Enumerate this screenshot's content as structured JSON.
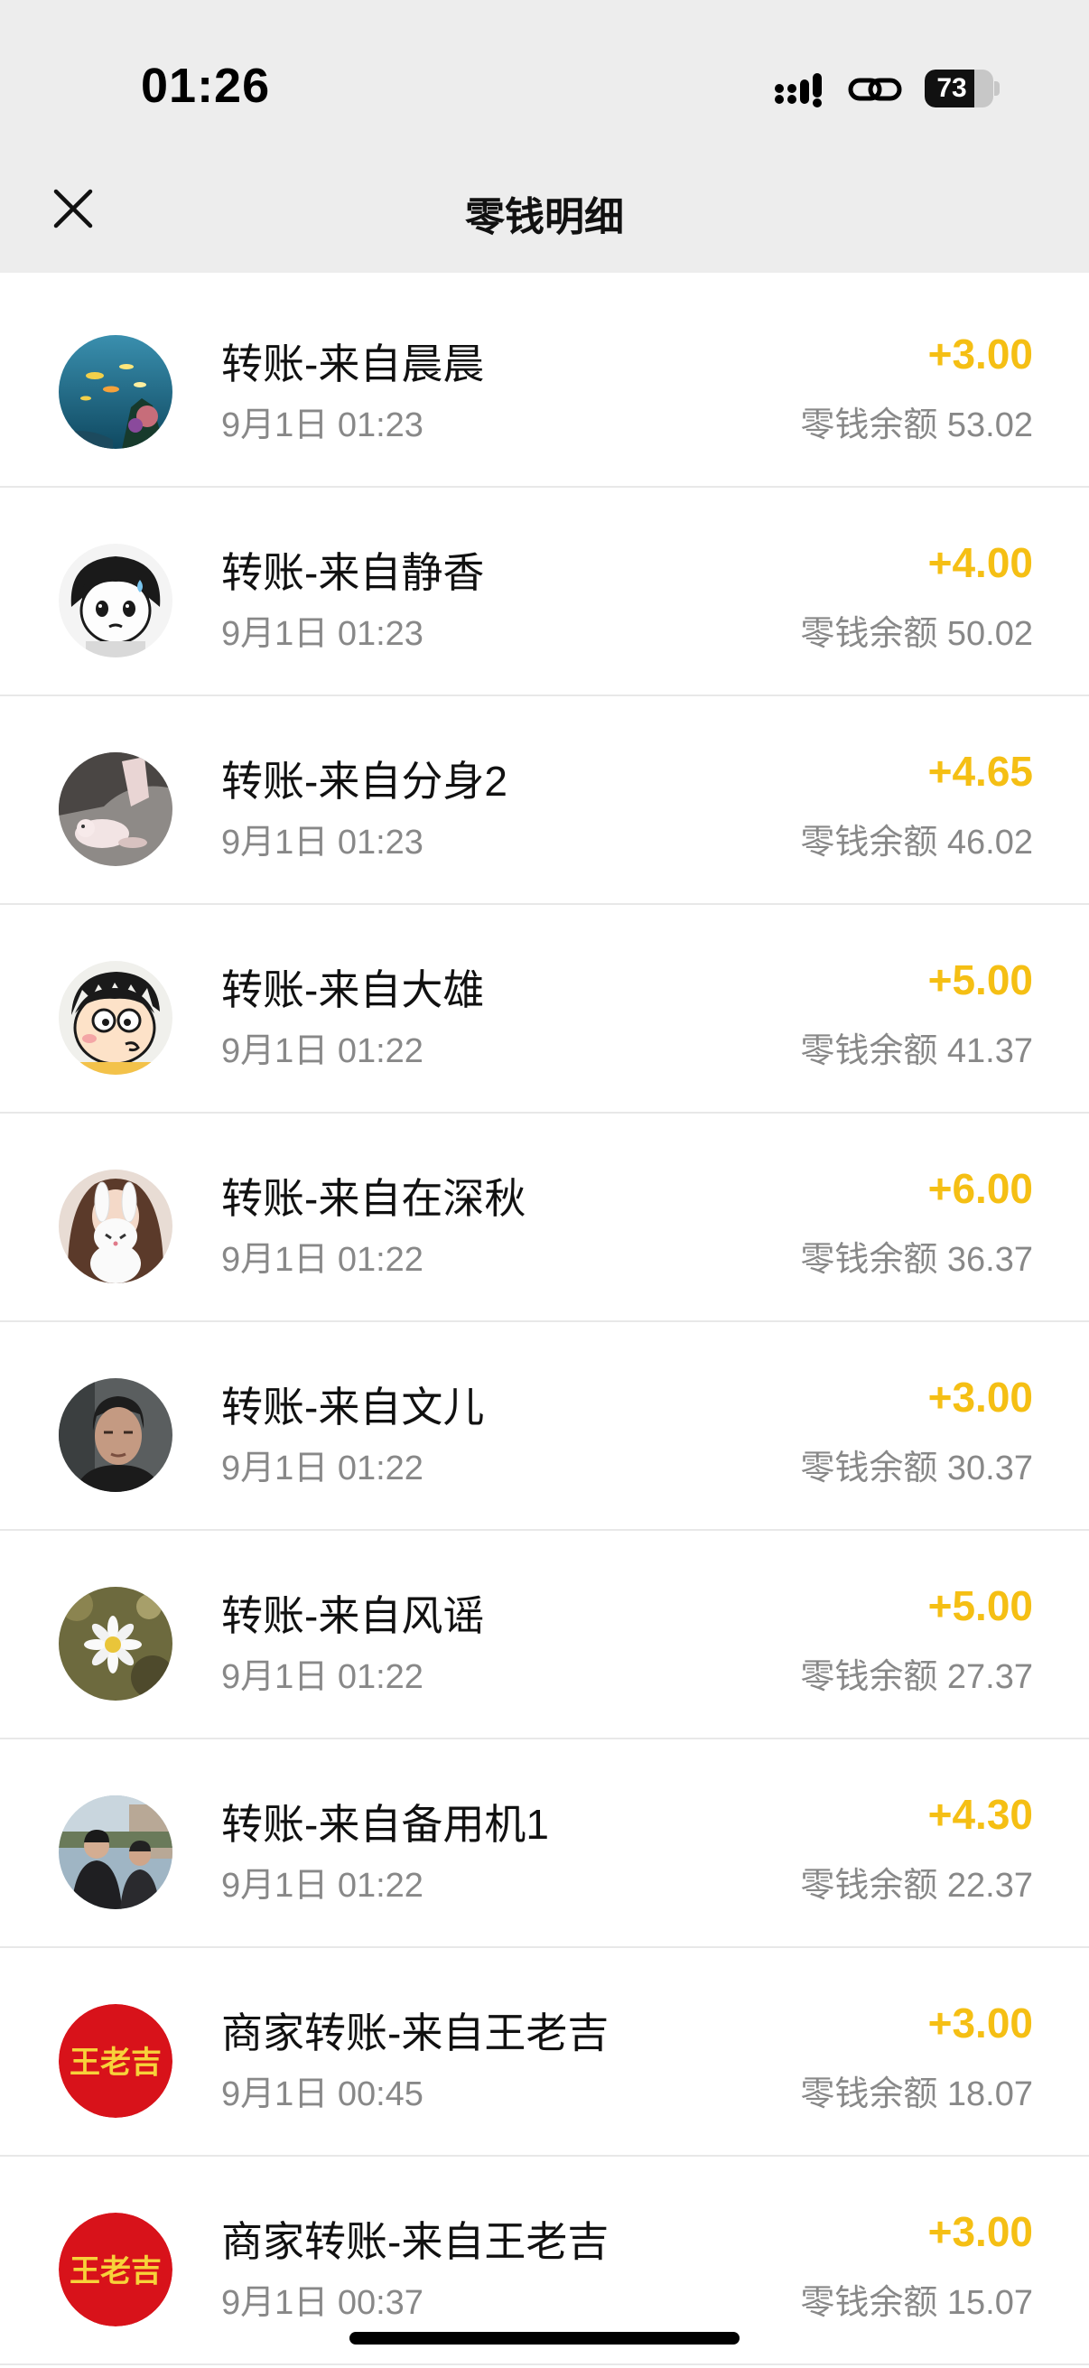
{
  "status_bar": {
    "time": "01:26",
    "battery": "73",
    "battery_level": 0.73
  },
  "header": {
    "title": "零钱明细"
  },
  "colors": {
    "amount": "#f5bf14",
    "header_bg": "#ededed",
    "secondary_text": "#888888"
  },
  "transactions": [
    {
      "title": "转账-来自晨晨",
      "date": "9月1日 01:23",
      "amount": "+3.00",
      "balance": "零钱余额 53.02",
      "avatar": "ocean-fish-avatar"
    },
    {
      "title": "转账-来自静香",
      "date": "9月1日 01:23",
      "amount": "+4.00",
      "balance": "零钱余额 50.02",
      "avatar": "cartoon-girl-avatar"
    },
    {
      "title": "转账-来自分身2",
      "date": "9月1日 01:23",
      "amount": "+4.65",
      "balance": "零钱余额 46.02",
      "avatar": "plush-toy-avatar"
    },
    {
      "title": "转账-来自大雄",
      "date": "9月1日 01:22",
      "amount": "+5.00",
      "balance": "零钱余额 41.37",
      "avatar": "cartoon-boy-avatar"
    },
    {
      "title": "转账-来自在深秋",
      "date": "9月1日 01:22",
      "amount": "+6.00",
      "balance": "零钱余额 36.37",
      "avatar": "girl-with-bunny-avatar"
    },
    {
      "title": "转账-来自文儿",
      "date": "9月1日 01:22",
      "amount": "+3.00",
      "balance": "零钱余额 30.37",
      "avatar": "man-portrait-avatar"
    },
    {
      "title": "转账-来自风谣",
      "date": "9月1日 01:22",
      "amount": "+5.00",
      "balance": "零钱余额 27.37",
      "avatar": "daisy-flower-avatar"
    },
    {
      "title": "转账-来自备用机1",
      "date": "9月1日 01:22",
      "amount": "+4.30",
      "balance": "零钱余额 22.37",
      "avatar": "men-in-suits-avatar"
    },
    {
      "title": "商家转账-来自王老吉",
      "date": "9月1日 00:45",
      "amount": "+3.00",
      "balance": "零钱余额 18.07",
      "avatar": "wanglaoji-logo-avatar",
      "logo_text": "王老吉"
    },
    {
      "title": "商家转账-来自王老吉",
      "date": "9月1日 00:37",
      "amount": "+3.00",
      "balance": "零钱余额 15.07",
      "avatar": "wanglaoji-logo-avatar",
      "logo_text": "王老吉"
    }
  ]
}
